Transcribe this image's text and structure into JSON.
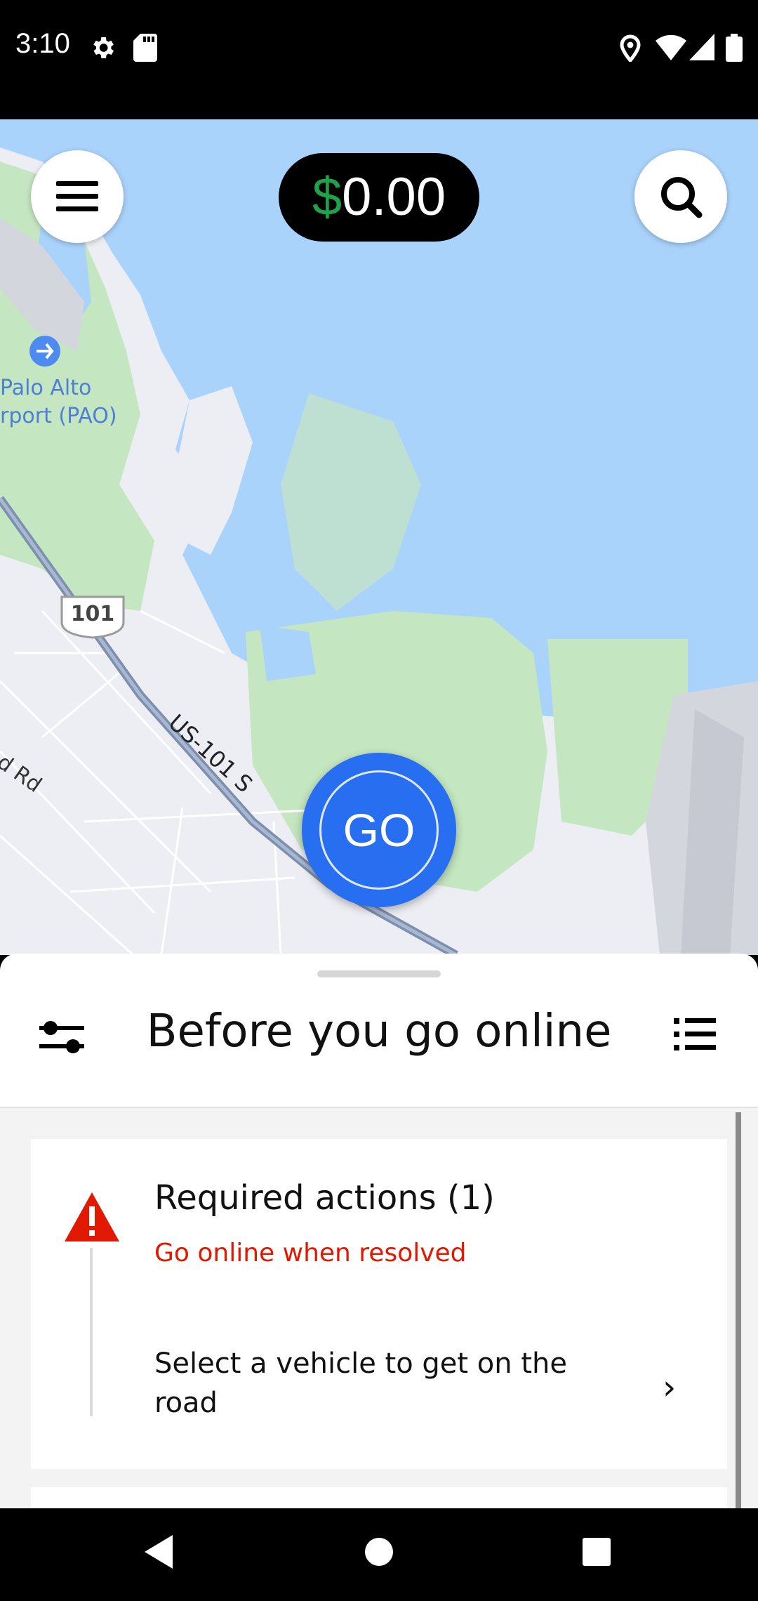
{
  "status_bar": {
    "time": "3:10",
    "left_icons": [
      "gear-icon",
      "sd-card-icon"
    ],
    "right_icons": [
      "location-pin-icon",
      "wifi-icon",
      "cellular-signal-icon",
      "battery-icon"
    ]
  },
  "map": {
    "labels": {
      "airport_line1": "Palo Alto",
      "airport_line2": "rport (PAO)",
      "highway_shield": "101",
      "highway_name": "US-101 S",
      "road_name": "d Rd"
    }
  },
  "header": {
    "earnings_currency": "$",
    "earnings_amount": "0.00",
    "menu_icon": "hamburger-menu-icon",
    "search_icon": "search-icon"
  },
  "go_button": {
    "label": "GO"
  },
  "sheet": {
    "title": "Before you go online",
    "left_icon": "preferences-sliders-icon",
    "right_icon": "list-icon",
    "required": {
      "title": "Required actions (1)",
      "subtitle": "Go online when resolved",
      "item_text": "Select a vehicle to get on the road",
      "chevron": "›"
    }
  },
  "colors": {
    "accent_blue": "#276ef1",
    "earnings_green": "#1fa34a",
    "alert_red": "#e11900",
    "water": "#aad3fb",
    "park": "#c4e6c0"
  },
  "nav_bar": {
    "buttons": [
      "back-triangle-icon",
      "home-circle-icon",
      "recents-square-icon"
    ]
  }
}
